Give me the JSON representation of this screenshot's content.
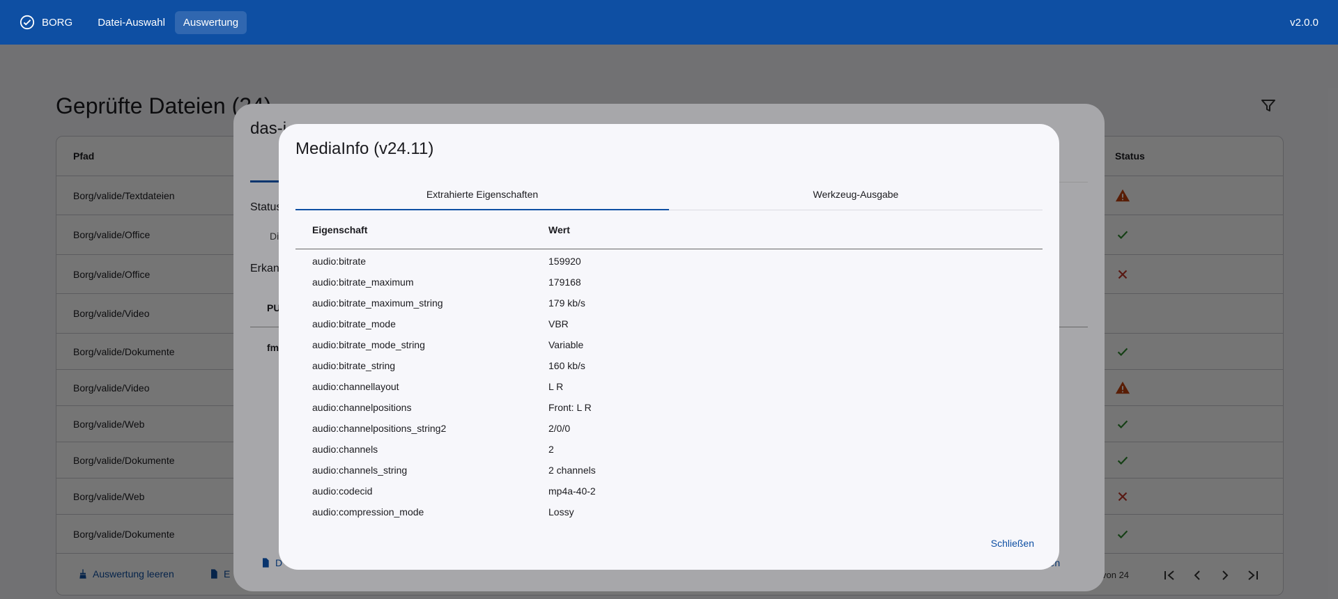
{
  "topbar": {
    "brand": "BORG",
    "nav": [
      "Datei-Auswahl",
      "Auswertung"
    ],
    "version": "v2.0.0"
  },
  "page": {
    "title": "Geprüfte Dateien (24)",
    "columns": {
      "path": "Pfad",
      "status": "Status"
    },
    "rows": [
      {
        "path": "Borg/valide/Textdateien",
        "status": "warning"
      },
      {
        "path": "Borg/valide/Office",
        "status": "ok"
      },
      {
        "path": "Borg/valide/Office",
        "status": "error"
      },
      {
        "path": "Borg/valide/Video",
        "status": "none"
      },
      {
        "path": "Borg/valide/Dokumente",
        "status": "ok"
      },
      {
        "path": "Borg/valide/Video",
        "status": "warning"
      },
      {
        "path": "Borg/valide/Web",
        "status": "ok"
      },
      {
        "path": "Borg/valide/Dokumente",
        "status": "ok"
      },
      {
        "path": "Borg/valide/Web",
        "status": "error"
      },
      {
        "path": "Borg/valide/Dokumente",
        "status": "ok"
      }
    ],
    "actions": {
      "clear": "Auswertung leeren",
      "export": "E"
    },
    "pager": {
      "text": "von 24"
    }
  },
  "outer_dialog": {
    "title": "das-i",
    "status_label": "Status",
    "di_text": "Di",
    "erk_label": "Erkan",
    "pu_header": "PU",
    "fm_text": "fm",
    "d_button": "D",
    "close_label": "ließen"
  },
  "dialog": {
    "title": "MediaInfo (v24.11)",
    "tabs": [
      "Extrahierte Eigenschaften",
      "Werkzeug-Ausgabe"
    ],
    "headers": {
      "property": "Eigenschaft",
      "value": "Wert"
    },
    "rows": [
      {
        "property": "audio:bitrate",
        "value": "159920"
      },
      {
        "property": "audio:bitrate_maximum",
        "value": "179168"
      },
      {
        "property": "audio:bitrate_maximum_string",
        "value": "179 kb/s"
      },
      {
        "property": "audio:bitrate_mode",
        "value": "VBR"
      },
      {
        "property": "audio:bitrate_mode_string",
        "value": "Variable"
      },
      {
        "property": "audio:bitrate_string",
        "value": "160 kb/s"
      },
      {
        "property": "audio:channellayout",
        "value": "L R"
      },
      {
        "property": "audio:channelpositions",
        "value": "Front: L R"
      },
      {
        "property": "audio:channelpositions_string2",
        "value": "2/0/0"
      },
      {
        "property": "audio:channels",
        "value": "2"
      },
      {
        "property": "audio:channels_string",
        "value": "2 channels"
      },
      {
        "property": "audio:codecid",
        "value": "mp4a-40-2"
      },
      {
        "property": "audio:compression_mode",
        "value": "Lossy"
      }
    ],
    "close_button": "Schließen"
  },
  "colors": {
    "primary": "#0e4fa3",
    "ok": "#2e8b2e",
    "warning": "#c2410c",
    "error": "#c0392b"
  }
}
